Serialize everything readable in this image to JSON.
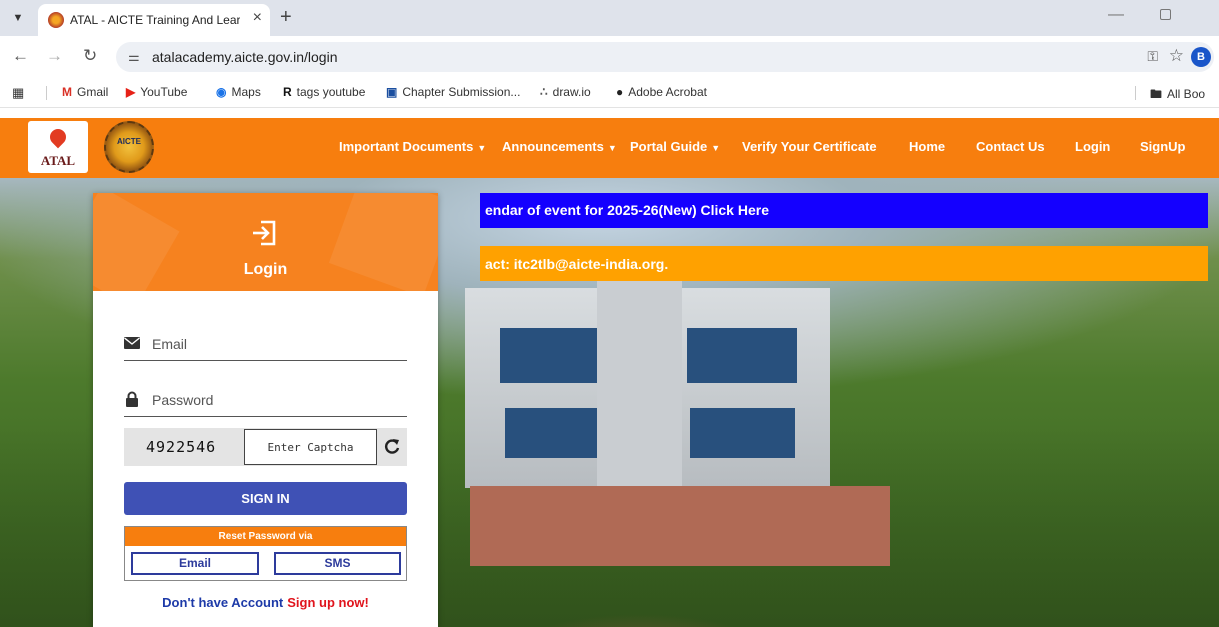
{
  "browser": {
    "tab_title": "ATAL - AICTE Training And Learn",
    "url": "atalacademy.aicte.gov.in/login",
    "profile_initial": "B",
    "bookmarks": [
      {
        "label": "Gmail",
        "icon": "gmail-icon"
      },
      {
        "label": "YouTube",
        "icon": "youtube-icon"
      },
      {
        "label": "Maps",
        "icon": "maps-icon"
      },
      {
        "label": "tags youtube",
        "icon": "r-icon"
      },
      {
        "label": "Chapter Submission...",
        "icon": "chapter-icon"
      },
      {
        "label": "draw.io",
        "icon": "drawio-icon"
      },
      {
        "label": "Adobe Acrobat",
        "icon": "acrobat-icon"
      }
    ],
    "all_bookmarks": "All Boo"
  },
  "nav": {
    "logo_atal": "ATAL",
    "logo_aicte": "AICTE",
    "items": [
      {
        "label": "Important Documents",
        "dropdown": true
      },
      {
        "label": "Announcements",
        "dropdown": true
      },
      {
        "label": "Portal Guide",
        "dropdown": true
      },
      {
        "label": "Verify Your Certificate",
        "dropdown": false
      },
      {
        "label": "Home",
        "dropdown": false
      },
      {
        "label": "Contact Us",
        "dropdown": false
      },
      {
        "label": "Login",
        "dropdown": false
      },
      {
        "label": "SignUp",
        "dropdown": false
      }
    ],
    "caret": "▼"
  },
  "tickers": {
    "calendar": "endar of event for 2025-26(New) Click Here",
    "contact": "act: itc2tlb@aicte-india.org."
  },
  "login": {
    "title": "Login",
    "email_placeholder": "Email",
    "password_placeholder": "Password",
    "captcha_code": "4922546",
    "captcha_placeholder": "Enter Captcha",
    "signin_label": "SIGN IN",
    "reset_heading": "Reset Password via",
    "reset_email": "Email",
    "reset_sms": "SMS",
    "no_account": "Don't have Account",
    "signup_link": "Sign up now!"
  },
  "colors": {
    "brand_orange": "#f77e0e",
    "primary_blue": "#3f51b5",
    "ticker_blue": "#1400ff",
    "ticker_orange": "#ffa100",
    "signup_red": "#e0141c"
  }
}
